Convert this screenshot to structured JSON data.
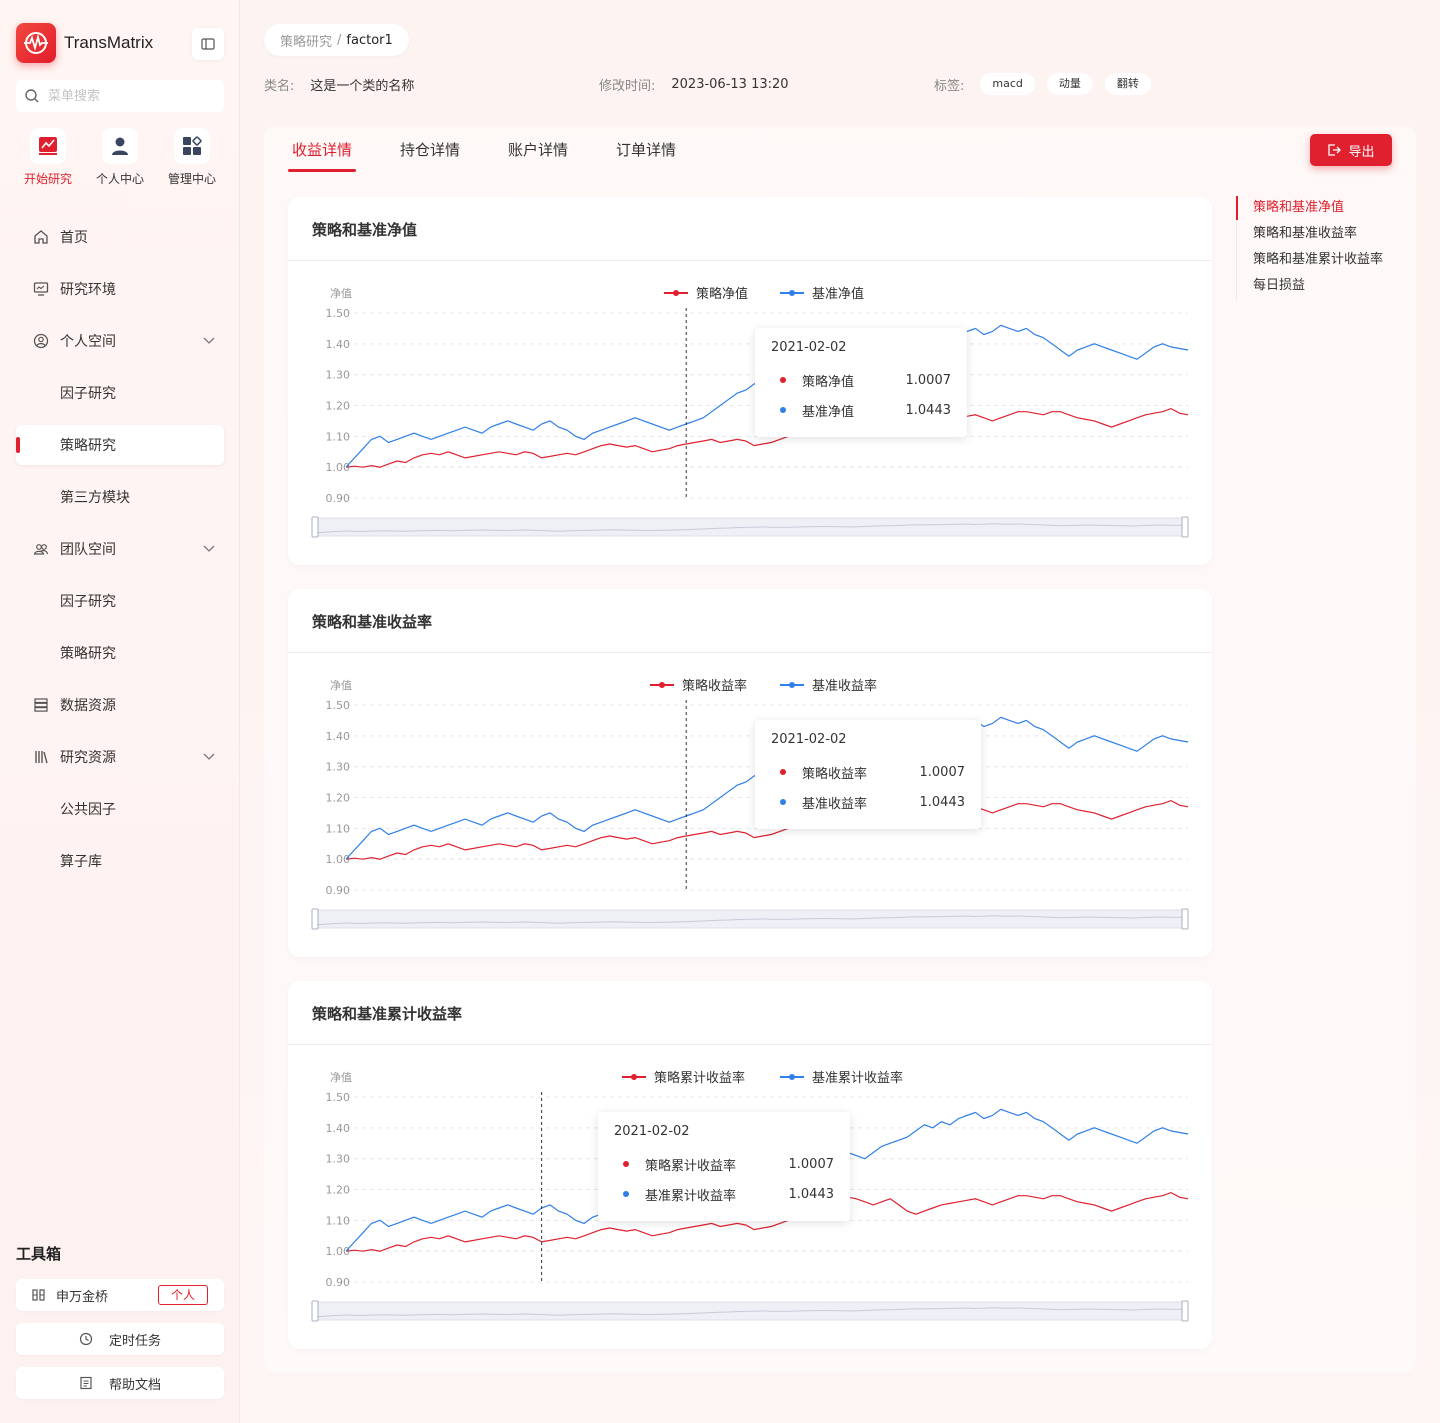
{
  "app": {
    "name": "TransMatrix"
  },
  "search": {
    "placeholder": "菜单搜索"
  },
  "quick_nav": [
    {
      "label": "开始研究",
      "icon": "chart-icon",
      "active": true
    },
    {
      "label": "个人中心",
      "icon": "user-icon",
      "active": false
    },
    {
      "label": "管理中心",
      "icon": "apps-icon",
      "active": false
    }
  ],
  "menu": [
    {
      "label": "首页",
      "icon": "home-icon",
      "type": "item"
    },
    {
      "label": "研究环境",
      "icon": "monitor-icon",
      "type": "item"
    },
    {
      "label": "个人空间",
      "icon": "user-circle-icon",
      "type": "group",
      "expanded": true
    },
    {
      "label": "因子研究",
      "type": "sub"
    },
    {
      "label": "策略研究",
      "type": "sub",
      "active": true
    },
    {
      "label": "第三方模块",
      "type": "sub"
    },
    {
      "label": "团队空间",
      "icon": "team-icon",
      "type": "group",
      "expanded": true
    },
    {
      "label": "因子研究",
      "type": "sub"
    },
    {
      "label": "策略研究",
      "type": "sub"
    },
    {
      "label": "数据资源",
      "icon": "database-icon",
      "type": "item"
    },
    {
      "label": "研究资源",
      "icon": "library-icon",
      "type": "group",
      "expanded": true
    },
    {
      "label": "公共因子",
      "type": "sub"
    },
    {
      "label": "算子库",
      "type": "sub"
    }
  ],
  "toolbox": {
    "title": "工具箱",
    "items": [
      {
        "label": "申万金桥",
        "icon": "bridge-icon",
        "badge": "个人"
      },
      {
        "label": "定时任务",
        "icon": "clock-icon"
      },
      {
        "label": "帮助文档",
        "icon": "doc-icon"
      }
    ]
  },
  "breadcrumb": {
    "parent": "策略研究",
    "separator": "/",
    "current": "factor1"
  },
  "meta": {
    "class_label": "类名:",
    "class_value": "这是一个类的名称",
    "modified_label": "修改时间:",
    "modified_value": "2023-06-13 13:20",
    "tags_label": "标签:",
    "tags": [
      "macd",
      "动量",
      "翻转"
    ]
  },
  "tabs": [
    "收益详情",
    "持仓详情",
    "账户详情",
    "订单详情"
  ],
  "active_tab": 0,
  "export_label": "导出",
  "anchors": [
    "策略和基准净值",
    "策略和基准收益率",
    "策略和基准累计收益率",
    "每日损益"
  ],
  "colors": {
    "accent": "#e0202e",
    "strategy": "#e0202e",
    "benchmark": "#2f7fe6"
  },
  "chart_data": [
    {
      "type": "line",
      "title": "策略和基准净值",
      "ylabel": "净值",
      "ylim": [
        0.9,
        1.5
      ],
      "yticks": [
        "1.50",
        "1.40",
        "1.30",
        "1.20",
        "1.10",
        "1.00",
        "0.90"
      ],
      "series": [
        {
          "name": "策略净值"
        },
        {
          "name": "基准净值"
        }
      ],
      "tooltip": {
        "date": "2021-02-02",
        "values": [
          "1.0007",
          "1.0443"
        ]
      }
    },
    {
      "type": "line",
      "title": "策略和基准收益率",
      "ylabel": "净值",
      "ylim": [
        0.9,
        1.5
      ],
      "yticks": [
        "1.50",
        "1.40",
        "1.30",
        "1.20",
        "1.10",
        "1.00",
        "0.90"
      ],
      "series": [
        {
          "name": "策略收益率"
        },
        {
          "name": "基准收益率"
        }
      ],
      "tooltip": {
        "date": "2021-02-02",
        "values": [
          "1.0007",
          "1.0443"
        ]
      }
    },
    {
      "type": "line",
      "title": "策略和基准累计收益率",
      "ylabel": "净值",
      "ylim": [
        0.9,
        1.5
      ],
      "yticks": [
        "1.50",
        "1.40",
        "1.30",
        "1.20",
        "1.10",
        "1.00",
        "0.90"
      ],
      "series": [
        {
          "name": "策略累计收益率"
        },
        {
          "name": "基准累计收益率"
        }
      ],
      "tooltip": {
        "date": "2021-02-02",
        "values": [
          "1.0007",
          "1.0443"
        ]
      }
    }
  ],
  "series_values": {
    "strategy": [
      1.0,
      1.003,
      1.0,
      1.005,
      1.0,
      1.01,
      1.02,
      1.015,
      1.03,
      1.04,
      1.045,
      1.04,
      1.05,
      1.04,
      1.03,
      1.035,
      1.04,
      1.045,
      1.05,
      1.045,
      1.04,
      1.05,
      1.045,
      1.03,
      1.035,
      1.04,
      1.045,
      1.04,
      1.05,
      1.06,
      1.07,
      1.075,
      1.07,
      1.065,
      1.07,
      1.06,
      1.05,
      1.055,
      1.06,
      1.07,
      1.075,
      1.08,
      1.085,
      1.09,
      1.08,
      1.085,
      1.09,
      1.085,
      1.07,
      1.075,
      1.08,
      1.09,
      1.1,
      1.12,
      1.14,
      1.15,
      1.16,
      1.17,
      1.18,
      1.175,
      1.17,
      1.16,
      1.15,
      1.16,
      1.17,
      1.15,
      1.13,
      1.12,
      1.13,
      1.14,
      1.15,
      1.155,
      1.16,
      1.165,
      1.17,
      1.16,
      1.15,
      1.16,
      1.17,
      1.18,
      1.18,
      1.175,
      1.17,
      1.18,
      1.18,
      1.17,
      1.16,
      1.155,
      1.15,
      1.14,
      1.13,
      1.14,
      1.15,
      1.16,
      1.17,
      1.175,
      1.18,
      1.19,
      1.175,
      1.17
    ],
    "benchmark": [
      1.0,
      1.03,
      1.06,
      1.09,
      1.1,
      1.08,
      1.09,
      1.1,
      1.11,
      1.1,
      1.09,
      1.1,
      1.11,
      1.12,
      1.13,
      1.12,
      1.11,
      1.13,
      1.14,
      1.15,
      1.14,
      1.13,
      1.12,
      1.14,
      1.15,
      1.13,
      1.12,
      1.1,
      1.09,
      1.11,
      1.12,
      1.13,
      1.14,
      1.15,
      1.16,
      1.15,
      1.14,
      1.13,
      1.12,
      1.13,
      1.14,
      1.15,
      1.16,
      1.18,
      1.2,
      1.22,
      1.24,
      1.25,
      1.27,
      1.28,
      1.29,
      1.3,
      1.29,
      1.28,
      1.29,
      1.3,
      1.31,
      1.32,
      1.33,
      1.32,
      1.31,
      1.3,
      1.32,
      1.34,
      1.35,
      1.36,
      1.37,
      1.39,
      1.41,
      1.4,
      1.42,
      1.41,
      1.43,
      1.44,
      1.45,
      1.43,
      1.44,
      1.46,
      1.45,
      1.44,
      1.45,
      1.43,
      1.42,
      1.4,
      1.38,
      1.36,
      1.38,
      1.39,
      1.4,
      1.39,
      1.38,
      1.37,
      1.36,
      1.35,
      1.37,
      1.39,
      1.4,
      1.39,
      1.385,
      1.38
    ]
  }
}
